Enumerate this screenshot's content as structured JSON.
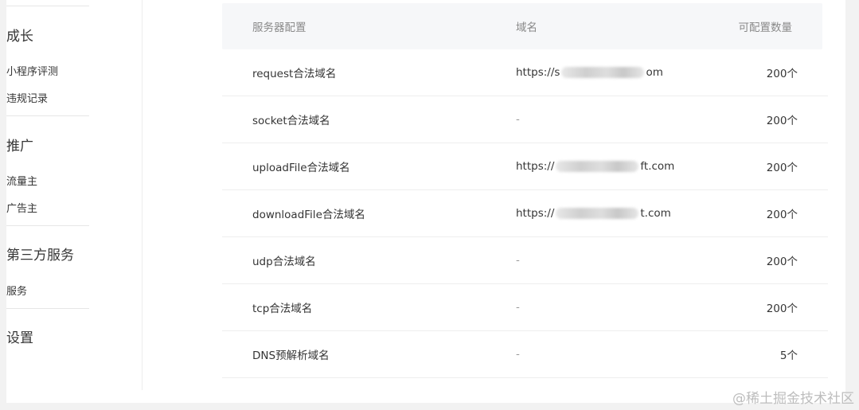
{
  "sidebar": {
    "sections": [
      {
        "heading": "成长",
        "items": [
          "小程序评测",
          "违规记录"
        ]
      },
      {
        "heading": "推广",
        "items": [
          "流量主",
          "广告主"
        ]
      },
      {
        "heading": "第三方服务",
        "items": [
          "服务"
        ]
      },
      {
        "heading": "设置",
        "items": []
      }
    ]
  },
  "table": {
    "headers": {
      "config": "服务器配置",
      "domain": "域名",
      "count": "可配置数量"
    },
    "rows": [
      {
        "config": "request合法域名",
        "domain_prefix": "https://s",
        "domain_suffix": "om",
        "count": "200个"
      },
      {
        "config": "socket合法域名",
        "domain": "-",
        "count": "200个"
      },
      {
        "config": "uploadFile合法域名",
        "domain_prefix": "https://",
        "domain_suffix": "ft.com",
        "count": "200个"
      },
      {
        "config": "downloadFile合法域名",
        "domain_prefix": "https://",
        "domain_suffix": "t.com",
        "count": "200个"
      },
      {
        "config": "udp合法域名",
        "domain": "-",
        "count": "200个"
      },
      {
        "config": "tcp合法域名",
        "domain": "-",
        "count": "200个"
      },
      {
        "config": "DNS预解析域名",
        "domain": "-",
        "count": "5个"
      }
    ]
  },
  "watermark": "@稀土掘金技术社区"
}
